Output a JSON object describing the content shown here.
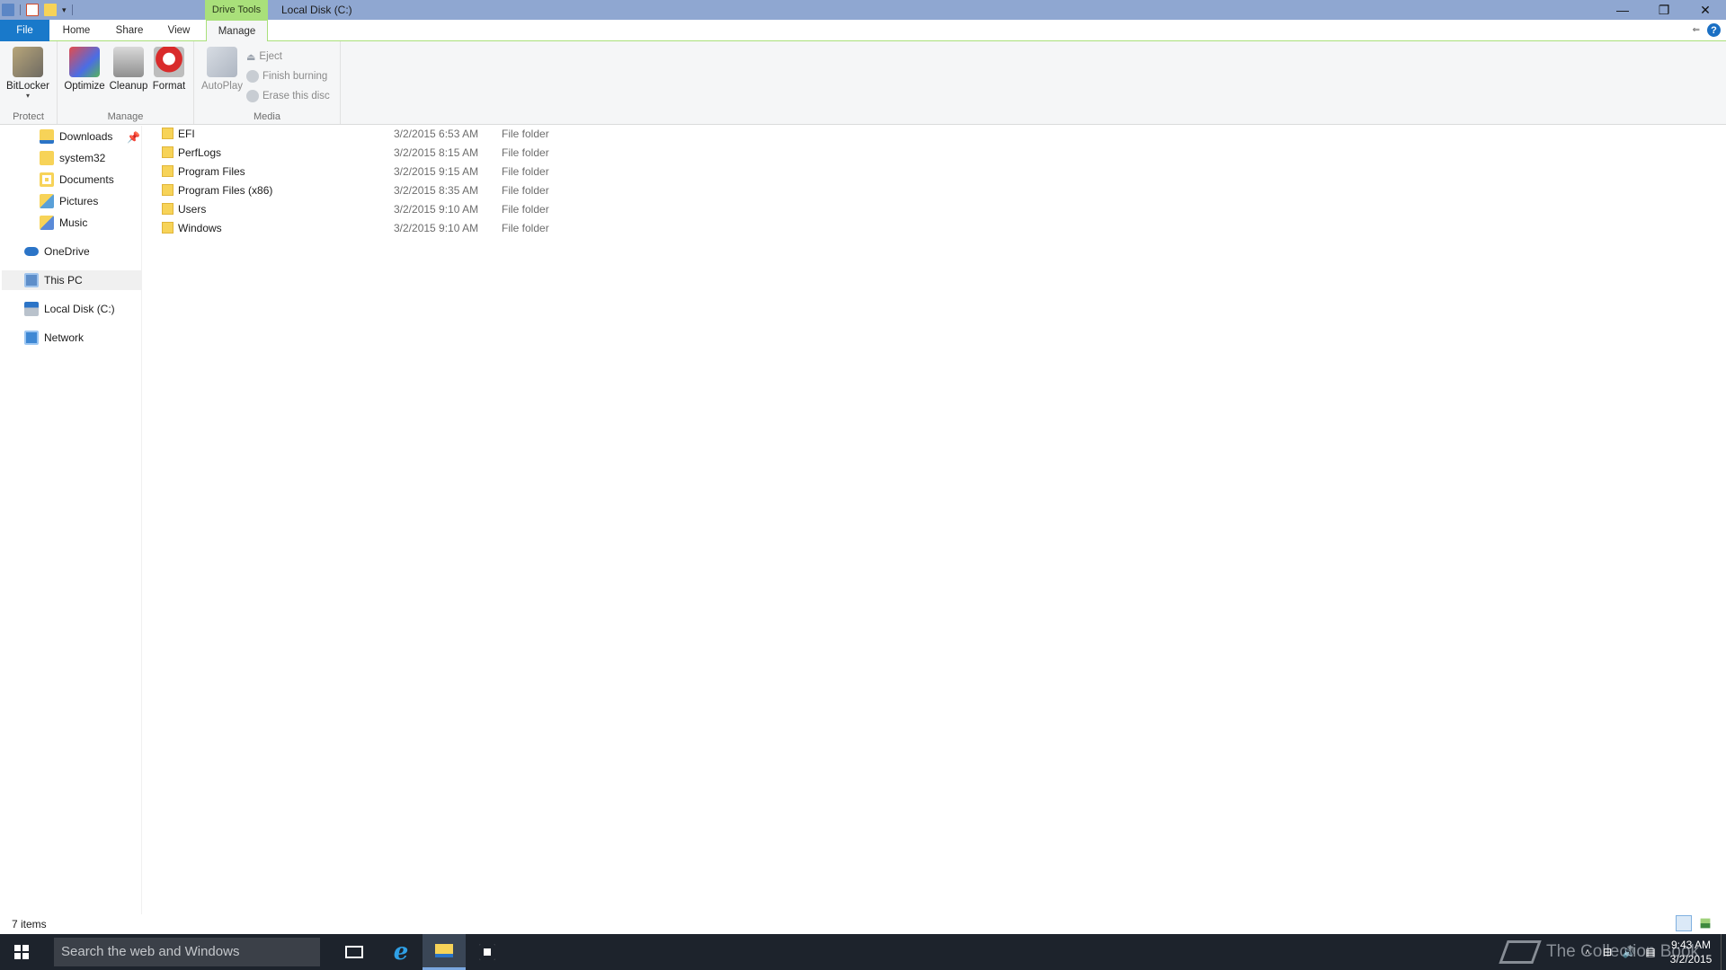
{
  "window": {
    "context_tab_label": "Drive Tools",
    "title": "Local Disk (C:)"
  },
  "tabs": {
    "file": "File",
    "home": "Home",
    "share": "Share",
    "view": "View",
    "manage": "Manage"
  },
  "ribbon": {
    "groups": {
      "protect": "Protect",
      "manage": "Manage",
      "media": "Media"
    },
    "buttons": {
      "bitlocker": "BitLocker",
      "optimize": "Optimize",
      "cleanup": "Cleanup",
      "format": "Format",
      "autoplay": "AutoPlay",
      "eject": "Eject",
      "finish_burning": "Finish burning",
      "erase_disc": "Erase this disc"
    }
  },
  "nav": {
    "items": [
      {
        "label": "Downloads"
      },
      {
        "label": "system32"
      },
      {
        "label": "Documents"
      },
      {
        "label": "Pictures"
      },
      {
        "label": "Music"
      },
      {
        "label": "OneDrive"
      },
      {
        "label": "This PC"
      },
      {
        "label": "Local Disk (C:)"
      },
      {
        "label": "Network"
      }
    ]
  },
  "files": [
    {
      "name": "EFI",
      "date": "3/2/2015 6:53 AM",
      "type": "File folder"
    },
    {
      "name": "PerfLogs",
      "date": "3/2/2015 8:15 AM",
      "type": "File folder"
    },
    {
      "name": "Program Files",
      "date": "3/2/2015 9:15 AM",
      "type": "File folder"
    },
    {
      "name": "Program Files (x86)",
      "date": "3/2/2015 8:35 AM",
      "type": "File folder"
    },
    {
      "name": "Users",
      "date": "3/2/2015 9:10 AM",
      "type": "File folder"
    },
    {
      "name": "Windows",
      "date": "3/2/2015 9:10 AM",
      "type": "File folder"
    }
  ],
  "status": {
    "item_count": "7 items"
  },
  "taskbar": {
    "search_placeholder": "Search the web and Windows",
    "time": "9:43 AM",
    "date": "3/2/2015",
    "watermark": "The Collection Book"
  },
  "colors": {
    "titlebar": "#8fa7d1",
    "context_tab": "#a9e07a",
    "file_tab": "#1979ca",
    "taskbar": "#1d232c",
    "folder": "#f7d358"
  }
}
